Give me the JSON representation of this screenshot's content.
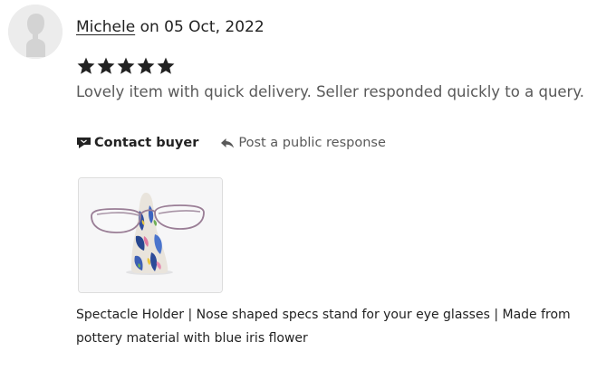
{
  "review": {
    "reviewer_name": "Michele",
    "date_text": "on 05 Oct, 2022",
    "rating": 5,
    "rating_max": 5,
    "text": "Lovely item with quick delivery. Seller responded quickly to a query."
  },
  "actions": {
    "contact_buyer": "Contact buyer",
    "post_response": "Post a public response"
  },
  "product": {
    "title": "Spectacle Holder | Nose shaped specs stand for your eye glasses | Made from pottery material with blue iris flower"
  },
  "icons": {
    "avatar": "default-user-avatar",
    "star": "star-icon",
    "contact": "message-flag-icon",
    "reply": "reply-arrow-icon"
  },
  "colors": {
    "text_primary": "#222222",
    "text_secondary": "#595959",
    "star": "#222222",
    "avatar_bg": "#ececec"
  }
}
